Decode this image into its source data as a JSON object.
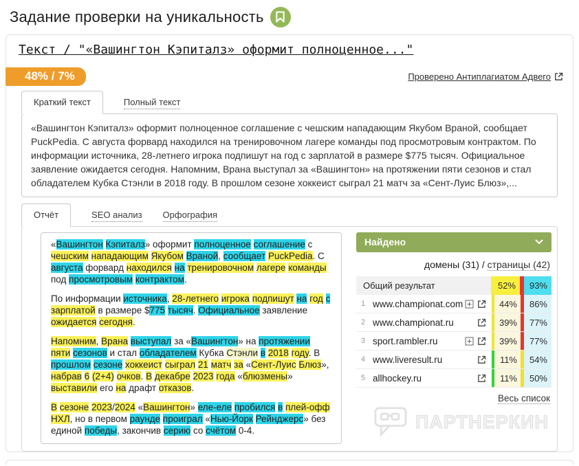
{
  "page": {
    "title": "Задание проверки на уникальность"
  },
  "subtitle": "Текст / \"«Вашингтон Кэпиталз» оформит полноценное...\"",
  "badge": {
    "text": "48% / 7%"
  },
  "verified_link": {
    "label": "Проверено Антиплагиатом Адвего"
  },
  "text_tabs": [
    {
      "label": "Краткий текст",
      "active": true
    },
    {
      "label": "Полный текст",
      "active": false
    }
  ],
  "summary_text": "«Вашингтон Кэпиталз» оформит полноценное соглашение с чешским нападающим Якубом Враной, сообщает PuckPedia. С августа форвард находился на тренировочном лагере команды под просмотровым контрактом. По информации источника, 28-летнего игрока подпишут на год с зарплатой в размере $775 тысяч. Официальное заявление ожидается сегодня. Напомним, Врана выступал за «Вашингтон» на протяжении пяти сезонов и стал обладателем Кубка Стэнли в 2018 году. В прошлом сезоне хоккеист сыграл 21 матч за «Сент-Луис Блюз»,...",
  "report_tabs": [
    {
      "label": "Отчёт",
      "active": true
    },
    {
      "label": "SEO анализ",
      "active": false
    },
    {
      "label": "Орфография",
      "active": false
    }
  ],
  "colors": {
    "badge_orange": "#EE9D2B",
    "header_green": "#90AB59",
    "bookmark_green": "#94B857",
    "highlight_yellow": "#FAF15A",
    "highlight_cyan": "#2ED4E8",
    "highlight_pale_yellow": "#F6F6C9",
    "total_yellow": "#F8EE3D",
    "total_cyan": "#4EDEF0",
    "bar_yellow": "#F2E433",
    "bar_green": "#37D13C",
    "sep_red": "#E2382D",
    "sep_yellow": "#F2E02E",
    "cell_pale_yellow": "#FBF7DF",
    "cell_pale_cyan": "#DCF4F9"
  },
  "report_paragraphs": [
    [
      [
        "«",
        ""
      ],
      [
        "Вашингтон",
        "c"
      ],
      [
        " ",
        ""
      ],
      [
        "Кэпиталз",
        "c"
      ],
      [
        "» оформит ",
        ""
      ],
      [
        "полноценное",
        "c"
      ],
      [
        " ",
        ""
      ],
      [
        "соглашение",
        "c"
      ],
      [
        " с ",
        ""
      ],
      [
        "чешским",
        "y"
      ],
      [
        " ",
        ""
      ],
      [
        "нападающим",
        "y"
      ],
      [
        " ",
        ""
      ],
      [
        "Якубом",
        "y"
      ],
      [
        " ",
        ""
      ],
      [
        "Враной",
        "c"
      ],
      [
        ", ",
        ""
      ],
      [
        "сообщает",
        "c"
      ],
      [
        " ",
        ""
      ],
      [
        "PuckPedia",
        "y"
      ],
      [
        ". С ",
        ""
      ],
      [
        "августа",
        "c"
      ],
      [
        " форвард ",
        ""
      ],
      [
        "находился",
        "y"
      ],
      [
        " ",
        ""
      ],
      [
        "на",
        "c"
      ],
      [
        " ",
        ""
      ],
      [
        "тренировочном",
        "y"
      ],
      [
        " ",
        ""
      ],
      [
        "лагере",
        "y"
      ],
      [
        " ",
        ""
      ],
      [
        "команды",
        "y"
      ],
      [
        " под ",
        ""
      ],
      [
        "просмотровым",
        "c"
      ],
      [
        " ",
        ""
      ],
      [
        "контрактом",
        "c"
      ],
      [
        ".",
        ""
      ]
    ],
    [
      [
        "По информации ",
        ""
      ],
      [
        "источника",
        "c"
      ],
      [
        ", ",
        ""
      ],
      [
        "28-летнего",
        "y"
      ],
      [
        " ",
        ""
      ],
      [
        "игрока",
        "y"
      ],
      [
        " ",
        ""
      ],
      [
        "подпишут",
        "y"
      ],
      [
        " ",
        ""
      ],
      [
        "на",
        "c"
      ],
      [
        " ",
        ""
      ],
      [
        "год",
        "y"
      ],
      [
        " ",
        ""
      ],
      [
        "с",
        "c"
      ],
      [
        " ",
        ""
      ],
      [
        "зарплатой",
        "y"
      ],
      [
        " в размере $",
        ""
      ],
      [
        "775",
        "c"
      ],
      [
        " ",
        ""
      ],
      [
        "тысяч",
        "c"
      ],
      [
        ". ",
        ""
      ],
      [
        "Официальное",
        "c"
      ],
      [
        " заявление ",
        ""
      ],
      [
        "ожидается",
        "y"
      ],
      [
        " ",
        ""
      ],
      [
        "сегодня",
        "y"
      ],
      [
        ".",
        ""
      ]
    ],
    [
      [
        "Напомним",
        "y"
      ],
      [
        ", ",
        ""
      ],
      [
        "Врана",
        "y"
      ],
      [
        " ",
        ""
      ],
      [
        "выступал",
        "c"
      ],
      [
        " за «",
        ""
      ],
      [
        "Вашингтон",
        "c"
      ],
      [
        "» на ",
        ""
      ],
      [
        "протяжении",
        "c"
      ],
      [
        " ",
        ""
      ],
      [
        "пяти",
        "y"
      ],
      [
        " ",
        ""
      ],
      [
        "сезонов",
        "c"
      ],
      [
        " и стал ",
        ""
      ],
      [
        "обладателем",
        "c"
      ],
      [
        " Кубка ",
        ""
      ],
      [
        "Стэнли",
        "pale"
      ],
      [
        " ",
        ""
      ],
      [
        "в",
        "c"
      ],
      [
        " ",
        ""
      ],
      [
        "2018",
        "y"
      ],
      [
        " ",
        ""
      ],
      [
        "году",
        "y"
      ],
      [
        ". В ",
        ""
      ],
      [
        "прошлом",
        "c"
      ],
      [
        " ",
        ""
      ],
      [
        "сезоне",
        "c"
      ],
      [
        " ",
        ""
      ],
      [
        "хоккеист",
        "y"
      ],
      [
        " ",
        ""
      ],
      [
        "сыграл",
        "y"
      ],
      [
        " ",
        ""
      ],
      [
        "21",
        "y"
      ],
      [
        " ",
        ""
      ],
      [
        "матч",
        "y"
      ],
      [
        " ",
        ""
      ],
      [
        "за",
        "y"
      ],
      [
        " «",
        ""
      ],
      [
        "Сент-Луис",
        "y"
      ],
      [
        " ",
        ""
      ],
      [
        "Блюз",
        "y"
      ],
      [
        "», ",
        ""
      ],
      [
        "набрав",
        "y"
      ],
      [
        " ",
        ""
      ],
      [
        "6",
        "y"
      ],
      [
        " ",
        ""
      ],
      [
        "(2+4)",
        "y"
      ],
      [
        " ",
        ""
      ],
      [
        "очков",
        "y"
      ],
      [
        ". ",
        ""
      ],
      [
        "В",
        "y"
      ],
      [
        " ",
        ""
      ],
      [
        "декабре",
        "y"
      ],
      [
        " ",
        ""
      ],
      [
        "2023",
        "y"
      ],
      [
        " ",
        ""
      ],
      [
        "года",
        "y"
      ],
      [
        " «",
        ""
      ],
      [
        "блюзмены",
        "y"
      ],
      [
        "» ",
        ""
      ],
      [
        "выставили",
        "y"
      ],
      [
        " его ",
        ""
      ],
      [
        "на",
        "y"
      ],
      [
        " драфт ",
        ""
      ],
      [
        "отказов",
        "y"
      ],
      [
        ".",
        ""
      ]
    ],
    [
      [
        "В",
        "y"
      ],
      [
        " ",
        ""
      ],
      [
        "сезоне",
        "y"
      ],
      [
        " ",
        ""
      ],
      [
        "2023",
        "y"
      ],
      [
        "/",
        ""
      ],
      [
        "2024",
        "y"
      ],
      [
        " «",
        ""
      ],
      [
        "Вашингтон",
        "y"
      ],
      [
        "» ",
        ""
      ],
      [
        "еле-еле",
        "c"
      ],
      [
        " ",
        ""
      ],
      [
        "пробился",
        "c"
      ],
      [
        " ",
        ""
      ],
      [
        "в",
        "c"
      ],
      [
        " ",
        ""
      ],
      [
        "плей-офф",
        "y"
      ],
      [
        " ",
        ""
      ],
      [
        "НХЛ",
        "y"
      ],
      [
        ", но в первом ",
        ""
      ],
      [
        "раунде",
        "c"
      ],
      [
        " ",
        ""
      ],
      [
        "проиграл",
        "c"
      ],
      [
        " «",
        ""
      ],
      [
        "Нью-Йорк",
        "c"
      ],
      [
        " ",
        ""
      ],
      [
        "Рейнджерс",
        "c"
      ],
      [
        "» без единой ",
        ""
      ],
      [
        "победы",
        "c"
      ],
      [
        ", закончив ",
        ""
      ],
      [
        "серию",
        "c"
      ],
      [
        " со ",
        ""
      ],
      [
        "счётом",
        "c"
      ],
      [
        " 0-4.",
        ""
      ]
    ]
  ],
  "sidebar": {
    "header": "Найдено",
    "domains_label": "домены (31)",
    "links_separator": "/",
    "pages_label": "страницы (42)",
    "total_label": "Общий результат",
    "total": {
      "v1": "52%",
      "v2": "93%"
    },
    "rows": [
      {
        "num": "1",
        "domain": "www.championat.com",
        "expand": true,
        "bar": "yellow",
        "sep": "red",
        "v1": "44%",
        "v2": "86%"
      },
      {
        "num": "2",
        "domain": "www.championat.ru",
        "expand": false,
        "bar": "yellow",
        "sep": "red",
        "v1": "39%",
        "v2": "77%"
      },
      {
        "num": "3",
        "domain": "sport.rambler.ru",
        "expand": true,
        "bar": "yellow",
        "sep": "red",
        "v1": "39%",
        "v2": "77%"
      },
      {
        "num": "4",
        "domain": "www.liveresult.ru",
        "expand": false,
        "bar": "green",
        "sep": "yellow",
        "v1": "11%",
        "v2": "54%"
      },
      {
        "num": "5",
        "domain": "allhockey.ru",
        "expand": false,
        "bar": "green",
        "sep": "yellow",
        "v1": "11%",
        "v2": "50%"
      }
    ],
    "all_list_label": "Весь список"
  },
  "watermark": {
    "text": "ПАРТНЕРКИН"
  }
}
